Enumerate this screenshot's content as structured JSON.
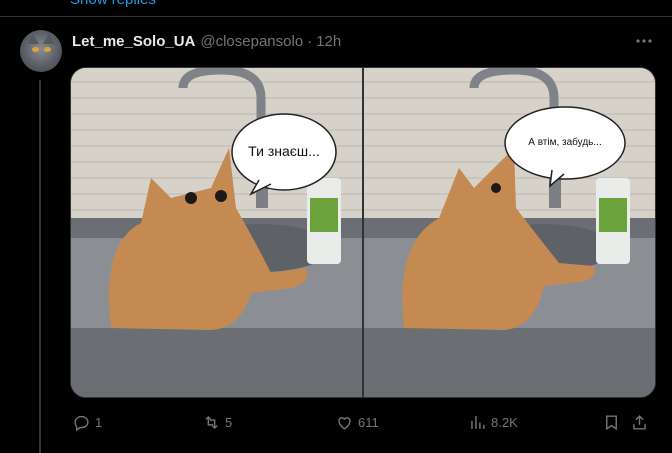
{
  "top": {
    "show_replies": "Show replies"
  },
  "post": {
    "display_name": "Let_me_Solo_UA",
    "handle": "@closepansolo",
    "separator": "·",
    "time": "12h",
    "bubble_left": "Ти знаєш...",
    "bubble_right": "А втім, забудь...",
    "replies": "1",
    "reposts": "5",
    "likes": "611",
    "views": "8.2K"
  },
  "colors": {
    "background": "#000000",
    "text": "#e7e9ea",
    "secondary": "#71767b",
    "border": "#2f3336",
    "link": "#1d9bf0"
  },
  "icons": [
    "avatar",
    "more-icon",
    "reply-icon",
    "repost-icon",
    "like-icon",
    "views-icon",
    "bookmark-icon",
    "share-icon"
  ]
}
